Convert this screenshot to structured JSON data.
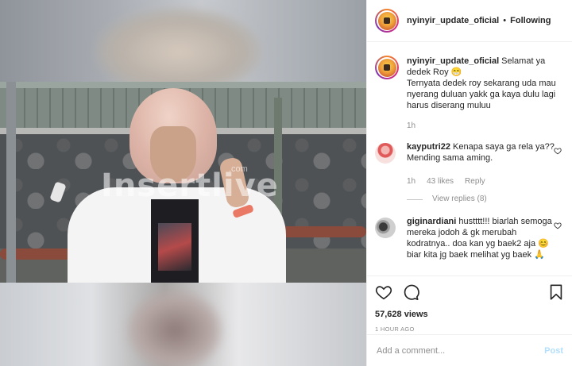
{
  "post": {
    "username": "nyinyir_update_oficial",
    "separator": "•",
    "follow_status": "Following"
  },
  "media": {
    "watermark": "Insertlive",
    "watermark_sup": ".com"
  },
  "caption": {
    "username": "nyinyir_update_oficial",
    "text_line1": "Selamat ya dedek Roy 😁",
    "text_line2": "Ternyata dedek roy sekarang uda mau nyerang duluan yakk ga kaya dulu lagi harus diserang muluu",
    "time": "1h"
  },
  "comments": [
    {
      "username": "kayputri22",
      "text": "Kenapa saya ga rela ya?? Mending sama aming.",
      "time": "1h",
      "likes": "43 likes",
      "reply_label": "Reply",
      "view_replies": "View replies (8)"
    },
    {
      "username": "giginardiani",
      "text": "hustttt!!! biarlah semoga mereka jodoh & gk merubah kodratnya.. doa kan yg baek2 aja 😊 biar kita jg baek melihat yg baek 🙏"
    }
  ],
  "stats": {
    "views": "57,628 views",
    "time_ago": "1 HOUR AGO"
  },
  "add_comment": {
    "placeholder": "Add a comment...",
    "post_label": "Post"
  },
  "colors": {
    "text": "#262626",
    "muted": "#8e8e8e",
    "border": "#efefef",
    "post_button_disabled": "#b2dffc"
  },
  "icons": [
    "heart-icon",
    "comment-icon",
    "bookmark-icon",
    "small-heart-icon"
  ]
}
